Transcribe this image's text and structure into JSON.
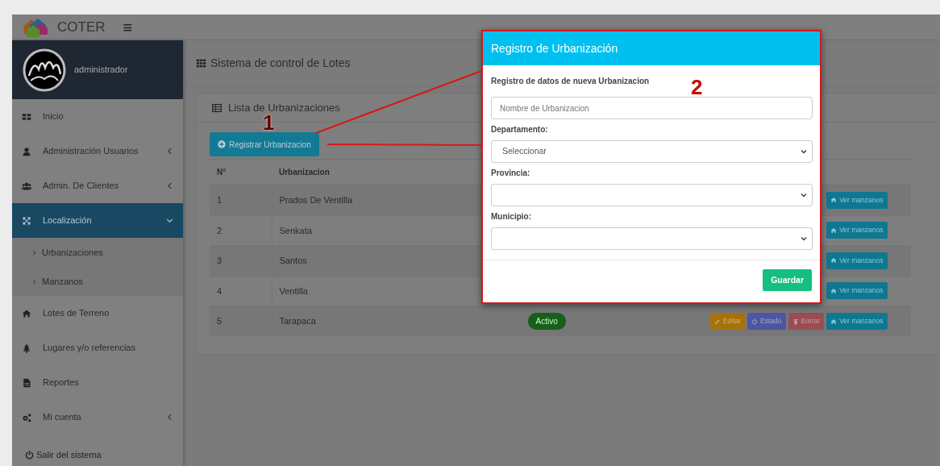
{
  "navbar": {
    "brand": "COTER",
    "menu_toggle": "≡"
  },
  "sidebar": {
    "user": "administrador",
    "items": [
      {
        "label": "Inicio",
        "selected": false
      },
      {
        "label": "Administración Usuarios",
        "selected": false,
        "expanded": false
      },
      {
        "label": "Admin. De Clientes",
        "selected": false,
        "expanded": false
      },
      {
        "label": "Localización",
        "selected": true,
        "expanded": true,
        "children": [
          {
            "label": "Urbanizaciones",
            "selected": false
          },
          {
            "label": "Manzanos",
            "selected": false
          }
        ]
      },
      {
        "label": "Lotes de Terreno",
        "selected": false
      },
      {
        "label": "Lugares y/o referencias",
        "selected": false
      },
      {
        "label": "Reportes",
        "selected": false
      },
      {
        "label": "Mi cuenta",
        "selected": false,
        "expanded": false
      }
    ],
    "logout": "Salir del sistema"
  },
  "page_title": "Sistema de control de Lotes",
  "card": {
    "title": "Lista de Urbanizaciones",
    "add_button": "Registrar Urbanizacion",
    "table": {
      "columns": [
        "N°",
        "Urbanizacion"
      ],
      "rows": [
        {
          "number": "1",
          "name": "Prados De Ventilla",
          "actions": [
            {
              "kind": "view",
              "label": "Ver manzanos"
            }
          ]
        },
        {
          "number": "2",
          "name": "Senkata",
          "actions": [
            {
              "kind": "view",
              "label": "Ver manzanos"
            }
          ]
        },
        {
          "number": "3",
          "name": "Santos",
          "actions": [
            {
              "kind": "view",
              "label": "Ver manzanos"
            }
          ]
        },
        {
          "number": "4",
          "name": "Ventilla",
          "actions": [
            {
              "kind": "view",
              "label": "Ver manzanos"
            }
          ]
        },
        {
          "number": "5",
          "name": "Tarapaca",
          "status": "Activo",
          "actions": [
            {
              "kind": "edit",
              "label": "Editar"
            },
            {
              "kind": "state",
              "label": "Estado"
            },
            {
              "kind": "delete",
              "label": "Borrar"
            },
            {
              "kind": "view",
              "label": "Ver manzanos"
            }
          ]
        }
      ]
    }
  },
  "modal": {
    "title": "Registro de Urbanización",
    "subtitle": "Registro de datos de nueva Urbanizacion",
    "fields": [
      {
        "kind": "text",
        "placeholder": "Nombre de Urbanizacion"
      },
      {
        "kind": "select",
        "label": "Departamento:",
        "value": "Seleccionar"
      },
      {
        "kind": "select",
        "label": "Provincia:"
      },
      {
        "kind": "select",
        "label": "Municipio:"
      }
    ],
    "save_button": "Guardar"
  },
  "annotations": [
    {
      "label": "1"
    },
    {
      "label": "2"
    }
  ]
}
